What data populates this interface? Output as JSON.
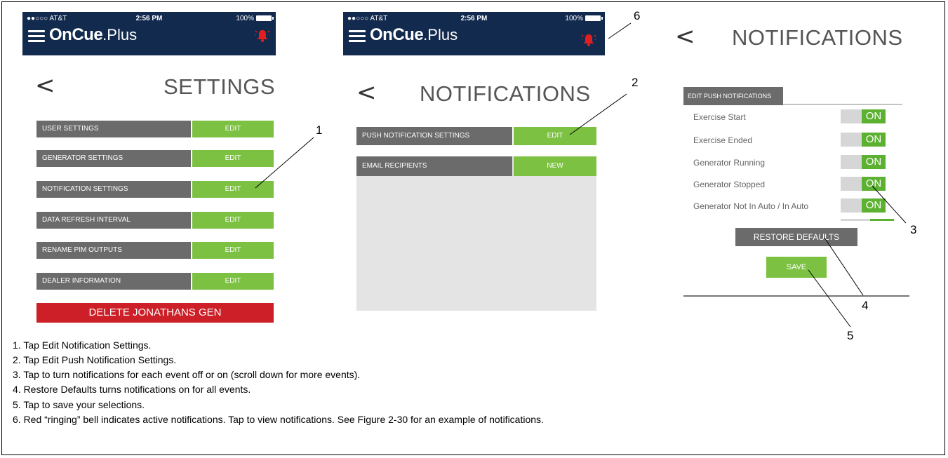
{
  "phone": {
    "carrier": "●●○○○ AT&T",
    "time": "2:56 PM",
    "battery": "100%",
    "brand_bold": "OnCue",
    "brand_light": ".Plus",
    "icons": {
      "menu": "hamburger-menu-icon",
      "bell": "ringing-bell-icon",
      "back": "chevron-left-icon"
    }
  },
  "settings_screen": {
    "title": "SETTINGS",
    "back": "<",
    "rows": [
      {
        "label": "USER SETTINGS",
        "action": "EDIT"
      },
      {
        "label": "GENERATOR SETTINGS",
        "action": "EDIT"
      },
      {
        "label": "NOTIFICATION SETTINGS",
        "action": "EDIT"
      },
      {
        "label": "DATA REFRESH INTERVAL",
        "action": "EDIT"
      },
      {
        "label": "RENAME PIM OUTPUTS",
        "action": "EDIT"
      },
      {
        "label": "DEALER INFORMATION",
        "action": "EDIT"
      }
    ],
    "delete_label": "DELETE JONATHANS GEN"
  },
  "notifications_screen": {
    "title": "NOTIFICATIONS",
    "back": "<",
    "rows": [
      {
        "label": "PUSH NOTIFICATION SETTINGS",
        "action": "EDIT"
      },
      {
        "label": "EMAIL RECIPIENTS",
        "action": "NEW"
      }
    ]
  },
  "push_screen": {
    "title": "NOTIFICATIONS",
    "back": "<",
    "tab_label": "EDIT PUSH NOTIFICATIONS",
    "events": [
      {
        "label": "Exercise Start",
        "state": "ON"
      },
      {
        "label": "Exercise Ended",
        "state": "ON"
      },
      {
        "label": "Generator Running",
        "state": "ON"
      },
      {
        "label": "Generator Stopped",
        "state": "ON"
      },
      {
        "label": "Generator Not In Auto / In Auto",
        "state": "ON"
      }
    ],
    "restore_label": "RESTORE DEFAULTS",
    "save_label": "SAVE"
  },
  "callouts": [
    "1",
    "2",
    "3",
    "4",
    "5",
    "6"
  ],
  "instructions": [
    "1. Tap Edit Notification Settings.",
    "2. Tap Edit Push Notification Settings.",
    "3. Tap to turn notifications for each event off or on (scroll down for more events).",
    "4. Restore Defaults turns notifications on for all events.",
    "5. Tap to save your selections.",
    "6. Red “ringing” bell indicates active notifications.  Tap to view notifications.  See Figure 2-30 for an example of notifications."
  ],
  "colors": {
    "header_navy": "#132a4f",
    "label_gray": "#6b6b6b",
    "edit_green": "#7cc142",
    "toggle_green": "#5cb130",
    "delete_red": "#cc1f27",
    "bell_red": "#e02020",
    "panel_gray": "#e4e4e4"
  }
}
